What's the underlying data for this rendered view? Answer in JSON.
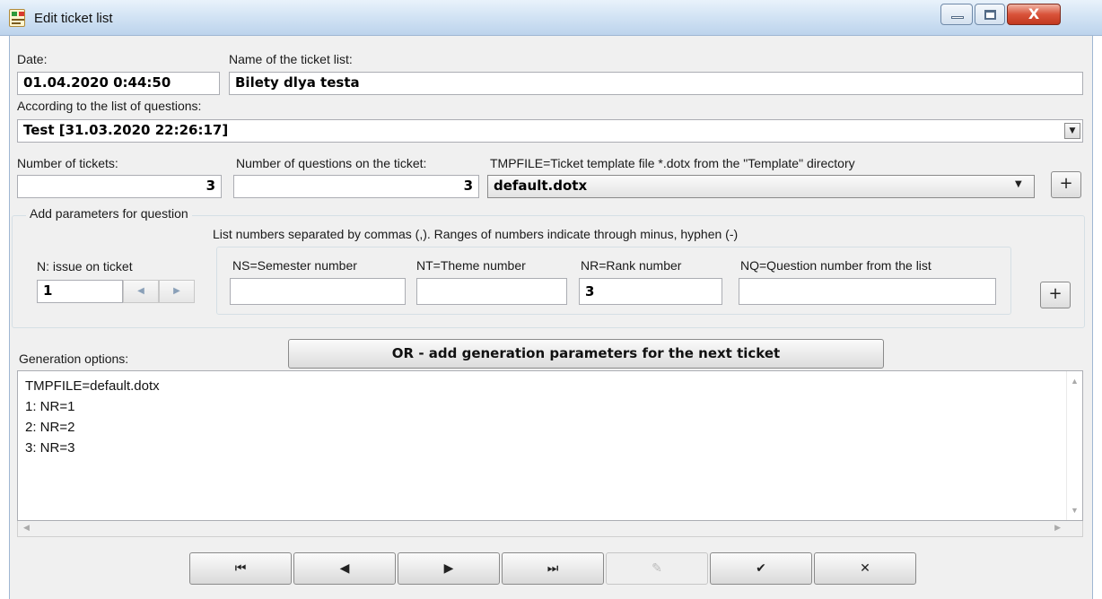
{
  "window": {
    "title": "Edit ticket list",
    "close_glyph": "X"
  },
  "form": {
    "date_label": "Date:",
    "date_value": "01.04.2020 0:44:50",
    "name_label": "Name of the ticket list:",
    "name_value": "Bilety dlya testa",
    "questions_list_label": "According to the list of questions:",
    "questions_list_value": "Test [31.03.2020 22:26:17]",
    "num_tickets_label": "Number of tickets:",
    "num_tickets_value": "3",
    "num_questions_label": "Number of questions on the ticket:",
    "num_questions_value": "3",
    "template_label": "TMPFILE=Ticket template file *.dotx from the \"Template\" directory",
    "template_value": "default.dotx",
    "add_button": "+"
  },
  "params_group": {
    "legend": "Add parameters for question",
    "hint": "List numbers separated by commas (,). Ranges of numbers indicate through minus, hyphen (-)",
    "n_label": "N: issue on ticket",
    "n_value": "1",
    "ns_label": "NS=Semester number",
    "ns_value": "",
    "nt_label": "NT=Theme number",
    "nt_value": "",
    "nr_label": "NR=Rank number",
    "nr_value": "3",
    "nq_label": "NQ=Question number from the list",
    "nq_value": "",
    "add_button": "+"
  },
  "generation": {
    "label": "Generation options:",
    "next_ticket_button": "OR - add generation parameters for the next ticket",
    "lines": [
      "TMPFILE=default.dotx",
      "1: NR=1",
      "2: NR=2",
      "3: NR=3"
    ]
  },
  "nav": {
    "first": "⏮",
    "prev": "◀",
    "next": "▶",
    "last": "⏭",
    "edit": "✎",
    "confirm": "✔",
    "cancel": "✕"
  }
}
